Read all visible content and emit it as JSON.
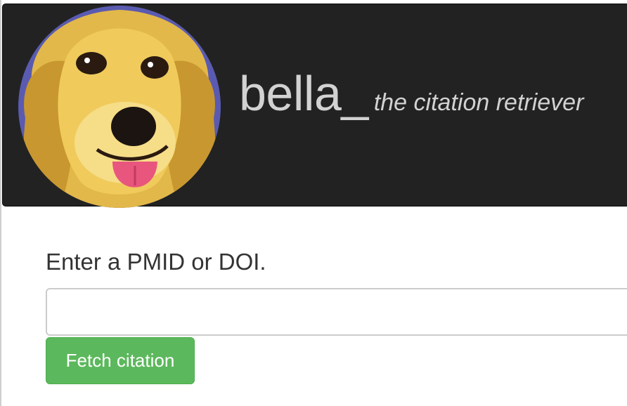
{
  "header": {
    "brand": "bella_",
    "tagline": "the citation retriever",
    "logo_icon": "golden-retriever-dog-portrait",
    "background_color": "#222222"
  },
  "form": {
    "prompt_label": "Enter a PMID or DOI.",
    "input_value": "",
    "input_placeholder": "",
    "submit_label": "Fetch citation",
    "submit_color": "#5cb85c"
  }
}
